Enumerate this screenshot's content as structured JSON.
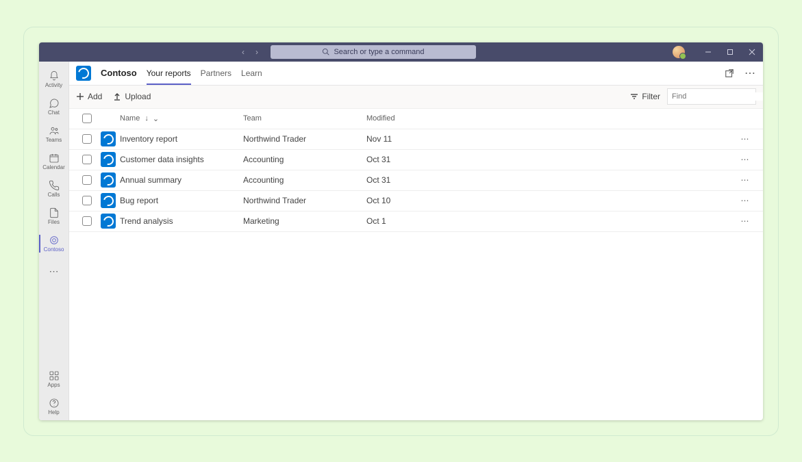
{
  "search": {
    "placeholder": "Search or type a command"
  },
  "rail": {
    "items": [
      {
        "label": "Activity"
      },
      {
        "label": "Chat"
      },
      {
        "label": "Teams"
      },
      {
        "label": "Calendar"
      },
      {
        "label": "Calls"
      },
      {
        "label": "Files"
      },
      {
        "label": "Contoso"
      }
    ],
    "bottom": [
      {
        "label": "Apps"
      },
      {
        "label": "Help"
      }
    ]
  },
  "header": {
    "appname": "Contoso",
    "tabs": [
      {
        "label": "Your reports"
      },
      {
        "label": "Partners"
      },
      {
        "label": "Learn"
      }
    ]
  },
  "toolbar": {
    "add": "Add",
    "upload": "Upload",
    "filter": "Filter",
    "find_placeholder": "Find"
  },
  "table": {
    "cols": {
      "name": "Name",
      "team": "Team",
      "modified": "Modified"
    },
    "rows": [
      {
        "name": "Inventory report",
        "team": "Northwind Trader",
        "modified": "Nov 11"
      },
      {
        "name": "Customer data insights",
        "team": "Accounting",
        "modified": "Oct 31"
      },
      {
        "name": "Annual summary",
        "team": "Accounting",
        "modified": "Oct 31"
      },
      {
        "name": "Bug report",
        "team": "Northwind Trader",
        "modified": "Oct 10"
      },
      {
        "name": "Trend analysis",
        "team": "Marketing",
        "modified": "Oct 1"
      }
    ]
  }
}
